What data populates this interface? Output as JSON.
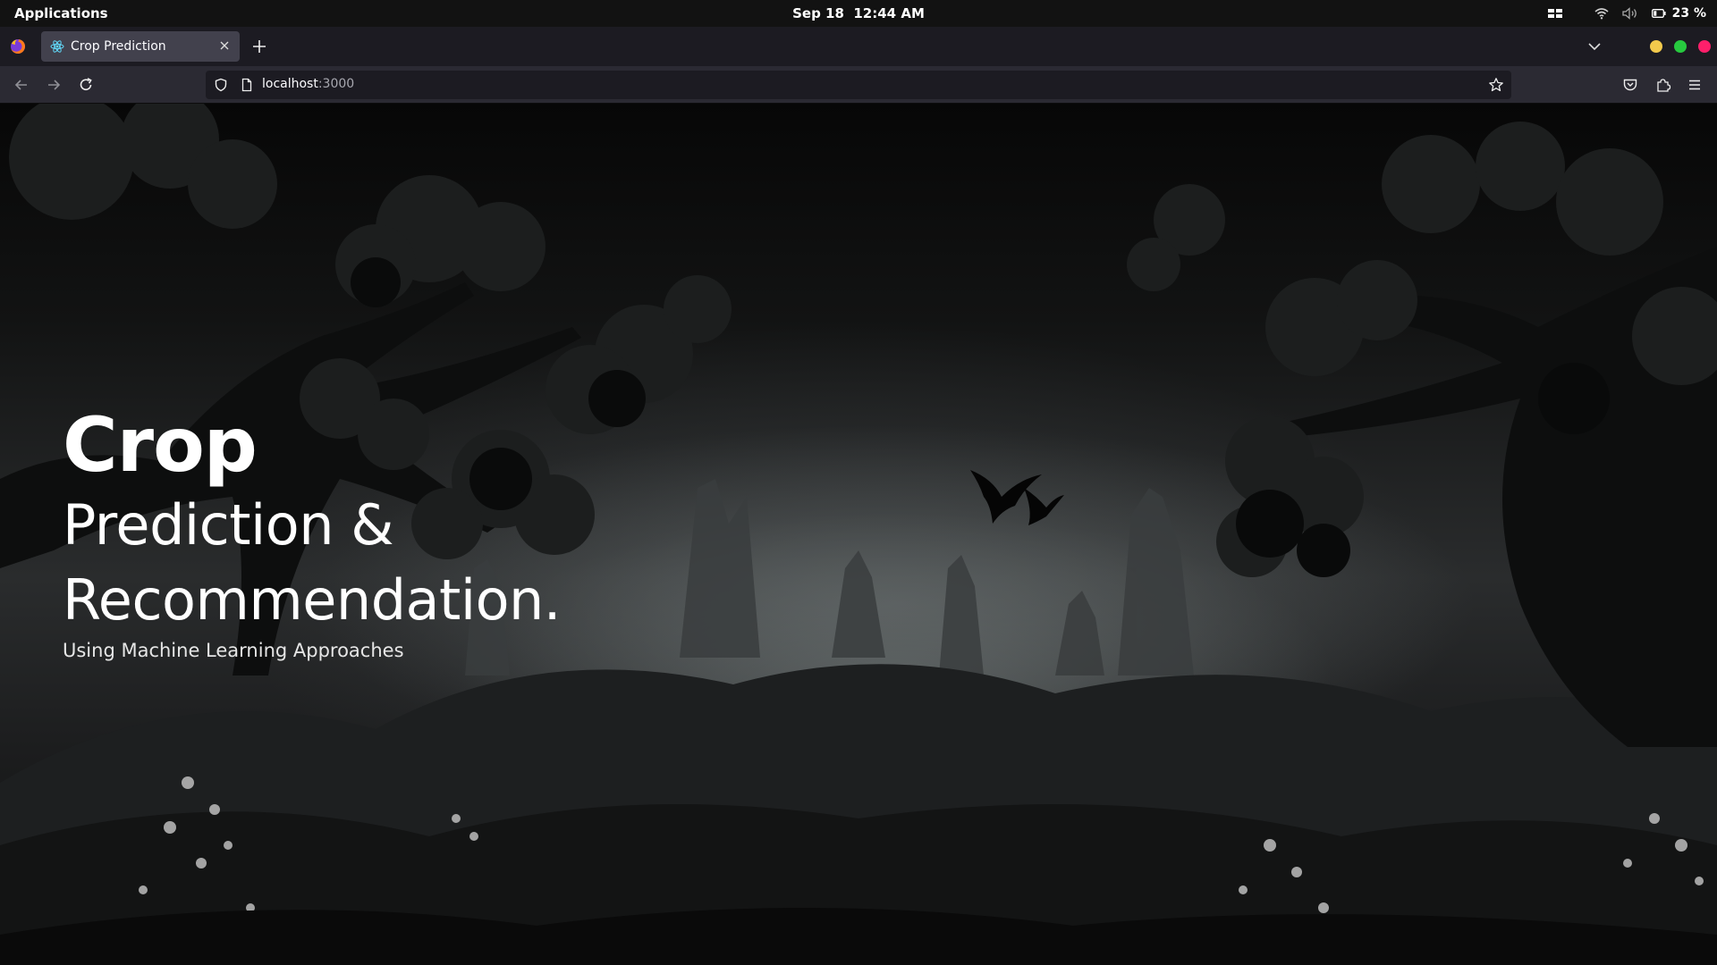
{
  "system_bar": {
    "apps_label": "Applications",
    "date": "Sep 18",
    "time": "12:44 AM",
    "battery": "23 %",
    "icons": [
      "workspaces-icon",
      "wifi-icon",
      "volume-icon",
      "battery-icon"
    ]
  },
  "browser": {
    "tab": {
      "title": "Crop Prediction",
      "favicon": "react-icon"
    },
    "url_host": "localhost",
    "url_port": ":3000",
    "window_buttons": {
      "minimize": "#f2c94c",
      "maximize": "#27c93f",
      "close": "#ff1f6b"
    }
  },
  "hero": {
    "title": "Crop",
    "subtitle_line1": "Prediction &",
    "subtitle_line2": "Recommendation.",
    "tagline": "Using Machine Learning Approaches"
  }
}
